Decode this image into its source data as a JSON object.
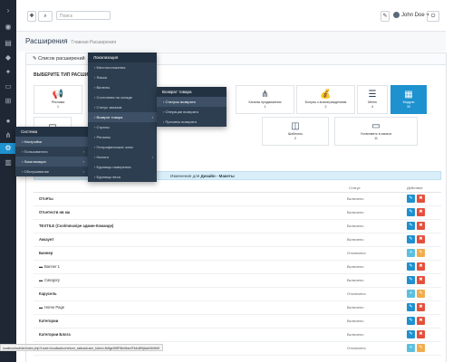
{
  "topbar": {
    "search_placeholder": "Поиск",
    "user_name": "John Doe",
    "user_caret": "▾",
    "logout_glyph": "⏻",
    "menu_toggle_glyph": "›",
    "home_glyph": "✚",
    "search_glyph": "⌕"
  },
  "page": {
    "title": "Расширения",
    "breadcrumb": "Главная  Расширения"
  },
  "panel": {
    "heading": "✎ Список расширений",
    "section_title": "ВЫБЕРИТЕ ТИП РАСШИРЕНИЯ"
  },
  "tiles_row1": [
    {
      "icon": "megaphone-icon",
      "glyph": "📢",
      "label": "Реклама",
      "count": "1"
    },
    {
      "icon": "share-icon",
      "glyph": "⋔",
      "label": "Каналы продвижения",
      "count": "1"
    },
    {
      "icon": "money-bag-icon",
      "glyph": "💰",
      "label": "Бонусы к вознаграждениям",
      "count": "2"
    },
    {
      "icon": "menu-icon",
      "glyph": "☰",
      "label": "Меню",
      "count": "4"
    },
    {
      "icon": "modules-icon",
      "glyph": "▦",
      "label": "Модули",
      "count": "30"
    }
  ],
  "tiles_row2": [
    {
      "icon": "window-icon",
      "glyph": "▭",
      "label": "",
      "count": ""
    },
    {
      "icon": "template-icon",
      "glyph": "◫",
      "label": "Шаблоны",
      "count": "2"
    },
    {
      "icon": "install-icon",
      "glyph": "▭",
      "label": "Установить в записи",
      "count": "11"
    }
  ],
  "info_bar": {
    "prefix": "Изменения для",
    "highlight": "Дизайн - Макеты"
  },
  "table": {
    "status_header": "Статус",
    "actions_header": "Действие",
    "rows": [
      {
        "name": "Отчёты",
        "status": "Включено",
        "sub": false,
        "buttons": "edit-delete"
      },
      {
        "name": "Отчетеств нв кш",
        "status": "Включено",
        "sub": false,
        "buttons": "edit-delete"
      },
      {
        "name": "TEXTILE (Coolmmasipe админ-Команде)",
        "status": "Включено",
        "sub": false,
        "buttons": "edit-delete"
      },
      {
        "name": "Аккаунт",
        "status": "Включено",
        "sub": false,
        "buttons": "edit-delete"
      },
      {
        "name": "Баннер",
        "status": "Отключено",
        "sub": false,
        "buttons": "add-edit"
      },
      {
        "name": "Banner 1",
        "status": "Включено",
        "sub": true,
        "buttons": "edit-delete"
      },
      {
        "name": "Category",
        "status": "Включено",
        "sub": true,
        "buttons": "edit-delete"
      },
      {
        "name": "Карусель",
        "status": "Отключено",
        "sub": false,
        "buttons": "add-edit"
      },
      {
        "name": "Home Page",
        "status": "Включено",
        "sub": true,
        "buttons": "edit-delete"
      },
      {
        "name": "Категории",
        "status": "Включено",
        "sub": false,
        "buttons": "edit-delete"
      },
      {
        "name": "Категории Блога",
        "status": "Включено",
        "sub": false,
        "buttons": "edit-delete"
      },
      {
        "name": "Последние статьи",
        "status": "Отключено",
        "sub": false,
        "buttons": "add-edit"
      }
    ]
  },
  "sidebar_menu": {
    "heading": "Система",
    "items": [
      {
        "label": "Настройки",
        "highlight": true,
        "arrow": ""
      },
      {
        "label": "Пользователи",
        "highlight": false,
        "arrow": "›"
      },
      {
        "label": "Локализация",
        "highlight": true,
        "arrow": "›"
      },
      {
        "label": "Обслуживание",
        "highlight": false,
        "arrow": "›"
      }
    ]
  },
  "localization_menu": {
    "heading": "Локализация",
    "items": [
      {
        "label": "Местоположения",
        "highlight": false,
        "arrow": ""
      },
      {
        "label": "Языки",
        "highlight": false,
        "arrow": ""
      },
      {
        "label": "Валюты",
        "highlight": false,
        "arrow": ""
      },
      {
        "label": "Состояния на складе",
        "highlight": false,
        "arrow": ""
      },
      {
        "label": "Статус заказов",
        "highlight": false,
        "arrow": ""
      },
      {
        "label": "Возврат товара",
        "highlight": true,
        "arrow": "›"
      },
      {
        "label": "Страны",
        "highlight": false,
        "arrow": ""
      },
      {
        "label": "Регионы",
        "highlight": false,
        "arrow": ""
      },
      {
        "label": "Географические зоны",
        "highlight": false,
        "arrow": ""
      },
      {
        "label": "Налоги",
        "highlight": false,
        "arrow": "›"
      },
      {
        "label": "Единицы измерения",
        "highlight": false,
        "arrow": ""
      },
      {
        "label": "Единицы веса",
        "highlight": false,
        "arrow": ""
      }
    ]
  },
  "returns_menu": {
    "heading": "Возврат товара",
    "items": [
      {
        "label": "Статусы возврата",
        "highlight": true
      },
      {
        "label": "Операции возврата",
        "highlight": false
      },
      {
        "label": "Причины возврата",
        "highlight": false
      }
    ]
  },
  "status_url": "localhost/admin/index.php?route=localisation/return_status&user_token=8dfgeDf8Ff8s9bsr4Fk4c8f9j&ah0b9bKf",
  "rail_icons": [
    "chevron-right-icon",
    "dashboard-icon",
    "catalog-icon",
    "tag-icon",
    "puzzle-icon",
    "desktop-icon",
    "cart-icon",
    "user-icon",
    "share-icon",
    "settings-icon",
    "chart-icon"
  ]
}
